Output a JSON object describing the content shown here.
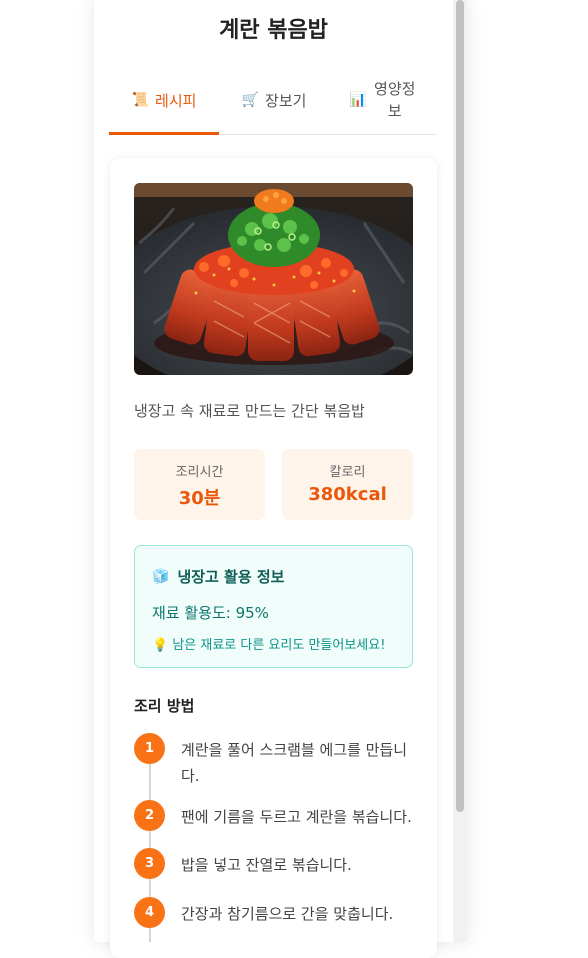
{
  "title": "계란 볶음밥",
  "tabs": [
    {
      "icon": "📜",
      "label": "레시피",
      "active": true
    },
    {
      "icon": "🛒",
      "label": "장보기",
      "active": false
    },
    {
      "icon": "📊",
      "label": "영양정보",
      "active": false
    }
  ],
  "recipe": {
    "description": "냉장고 속 재료로 만드는 간단 볶음밥",
    "stats": {
      "time_label": "조리시간",
      "time_value": "30분",
      "calorie_label": "칼로리",
      "calorie_value": "380kcal"
    },
    "fridge": {
      "icon": "🧊",
      "title": "냉장고 활용 정보",
      "usage": "재료 활용도: 95%",
      "tip": "💡 남은 재료로 다른 요리도 만들어보세요!"
    },
    "steps_title": "조리 방법",
    "steps": [
      {
        "num": "1",
        "text": "계란을 풀어 스크램블 에그를 만듭니다."
      },
      {
        "num": "2",
        "text": "팬에 기름을 두르고 계란을 볶습니다."
      },
      {
        "num": "3",
        "text": "밥을 넣고 잔열로 볶습니다."
      },
      {
        "num": "4",
        "text": "간장과 참기름으로 간을 맞춥니다."
      }
    ]
  },
  "colors": {
    "accent": "#ea580c",
    "step": "#f97316",
    "teal": "#0f766e"
  }
}
